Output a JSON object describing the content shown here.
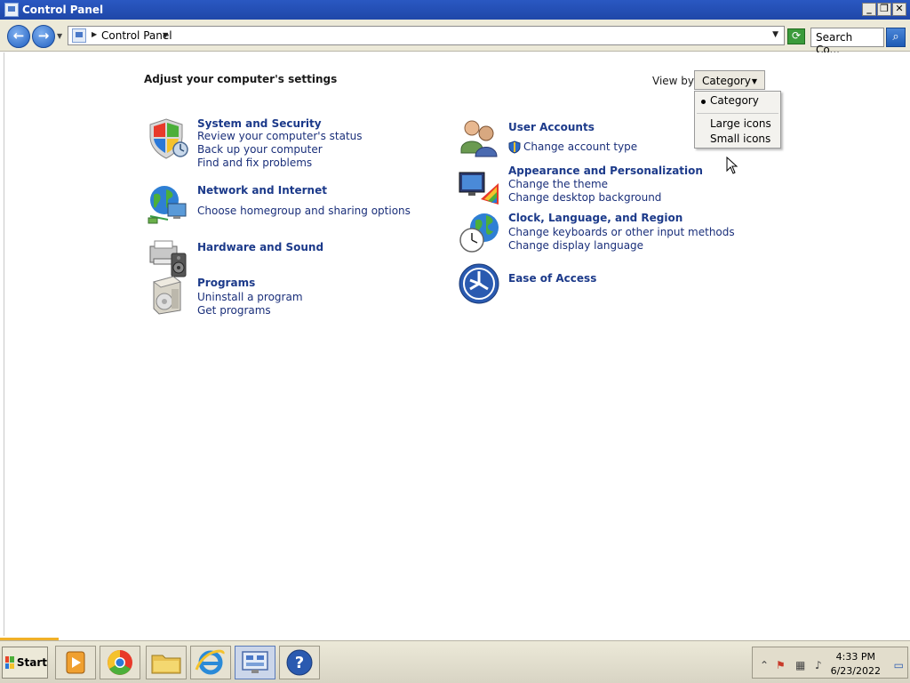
{
  "window": {
    "title": "Control Panel",
    "min_label": "_",
    "max_label": "❐",
    "close_label": "✕"
  },
  "address": {
    "crumb": "Control Panel",
    "search_placeholder": "Search Co...",
    "back_glyph": "←",
    "fwd_glyph": "→",
    "refresh_glyph": "⟳",
    "search_glyph": "⌕"
  },
  "main": {
    "title": "Adjust your computer's settings",
    "view_by_label": "View by:",
    "view_by_value": "Category"
  },
  "view_dropdown": {
    "options": [
      "Category",
      "Large icons",
      "Small icons"
    ],
    "selected": "Category"
  },
  "categories": [
    {
      "title": "System and Security",
      "links": [
        "Review your computer's status",
        "Back up your computer",
        "Find and fix problems"
      ]
    },
    {
      "title": "Network and Internet",
      "links": [
        "Choose homegroup and sharing options"
      ]
    },
    {
      "title": "Hardware and Sound",
      "links": []
    },
    {
      "title": "Programs",
      "links": [
        "Uninstall a program",
        "Get programs"
      ]
    },
    {
      "title": "User Accounts",
      "links": [
        "Change account type"
      ]
    },
    {
      "title": "Appearance and Personalization",
      "links": [
        "Change the theme",
        "Change desktop background"
      ]
    },
    {
      "title": "Clock, Language, and Region",
      "links": [
        "Change keyboards or other input methods",
        "Change display language"
      ]
    },
    {
      "title": "Ease of Access",
      "links": []
    }
  ],
  "taskbar": {
    "start_label": "Start",
    "apps": [
      "media-player-icon",
      "chrome-icon",
      "file-explorer-icon",
      "internet-explorer-icon",
      "control-panel-icon",
      "help-icon"
    ],
    "time": "4:33 PM",
    "date": "6/23/2022"
  }
}
